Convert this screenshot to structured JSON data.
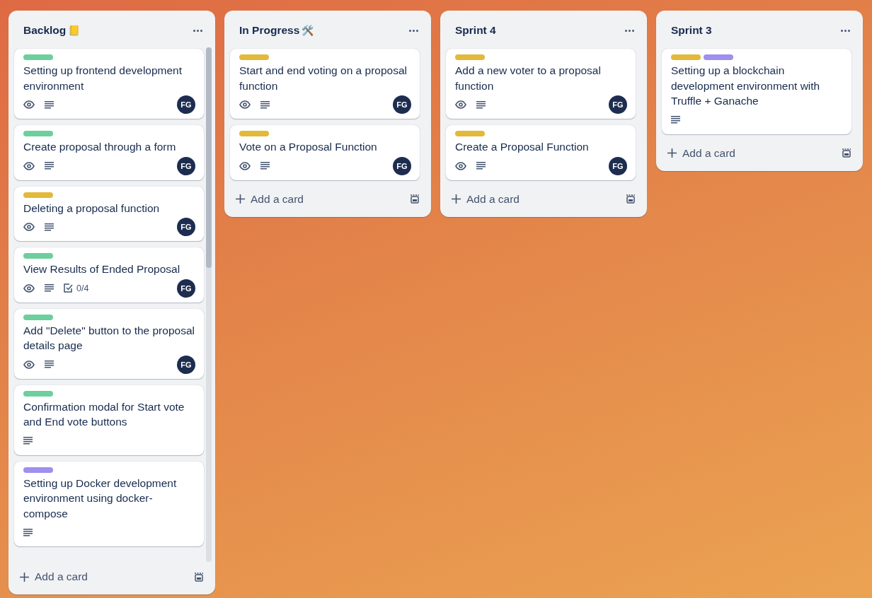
{
  "lists": [
    {
      "title": "Backlog",
      "title_emoji": "📒",
      "cards": [
        {
          "labels": [
            {
              "color": "#6ccf9d"
            }
          ],
          "title": "Setting up frontend development environment",
          "watching": true,
          "description": true,
          "member": "FG"
        },
        {
          "labels": [
            {
              "color": "#6ccf9d"
            }
          ],
          "title": "Create proposal through a form",
          "watching": true,
          "description": true,
          "member": "FG"
        },
        {
          "labels": [
            {
              "color": "#e2b93b"
            }
          ],
          "title": "Deleting a proposal function",
          "watching": true,
          "description": true,
          "member": "FG"
        },
        {
          "labels": [
            {
              "color": "#6ccf9d"
            }
          ],
          "title": "View Results of Ended Proposal",
          "watching": true,
          "description": true,
          "checklist": "0/4",
          "member": "FG"
        },
        {
          "labels": [
            {
              "color": "#6ccf9d"
            }
          ],
          "title": "Add \"Delete\" button to the proposal details page",
          "watching": true,
          "description": true,
          "member": "FG"
        },
        {
          "labels": [
            {
              "color": "#6ccf9d"
            }
          ],
          "title": "Confirmation modal for Start vote and End vote buttons",
          "watching": false,
          "description": true
        },
        {
          "labels": [
            {
              "color": "#9f8fef"
            }
          ],
          "title": "Setting up Docker development environment using docker-compose",
          "watching": false,
          "description": true
        }
      ],
      "add_label": "Add a card"
    },
    {
      "title": "In Progress",
      "title_emoji": "🛠️",
      "cards": [
        {
          "labels": [
            {
              "color": "#e2b93b"
            }
          ],
          "title": "Start and end voting on a proposal function",
          "watching": true,
          "description": true,
          "member": "FG"
        },
        {
          "labels": [
            {
              "color": "#e2b93b"
            }
          ],
          "title": "Vote on a Proposal Function",
          "watching": true,
          "description": true,
          "member": "FG"
        }
      ],
      "add_label": "Add a card"
    },
    {
      "title": "Sprint 4",
      "cards": [
        {
          "labels": [
            {
              "color": "#e2b93b"
            }
          ],
          "title": "Add a new voter to a proposal function",
          "watching": true,
          "description": true,
          "member": "FG"
        },
        {
          "labels": [
            {
              "color": "#e2b93b"
            }
          ],
          "title": "Create a Proposal Function",
          "watching": true,
          "description": true,
          "member": "FG"
        }
      ],
      "add_label": "Add a card"
    },
    {
      "title": "Sprint 3",
      "cards": [
        {
          "labels": [
            {
              "color": "#e2b93b"
            },
            {
              "color": "#9f8fef"
            }
          ],
          "title": "Setting up a blockchain development environment with Truffle + Ganache",
          "watching": false,
          "description": true
        }
      ],
      "add_label": "Add a card"
    }
  ]
}
